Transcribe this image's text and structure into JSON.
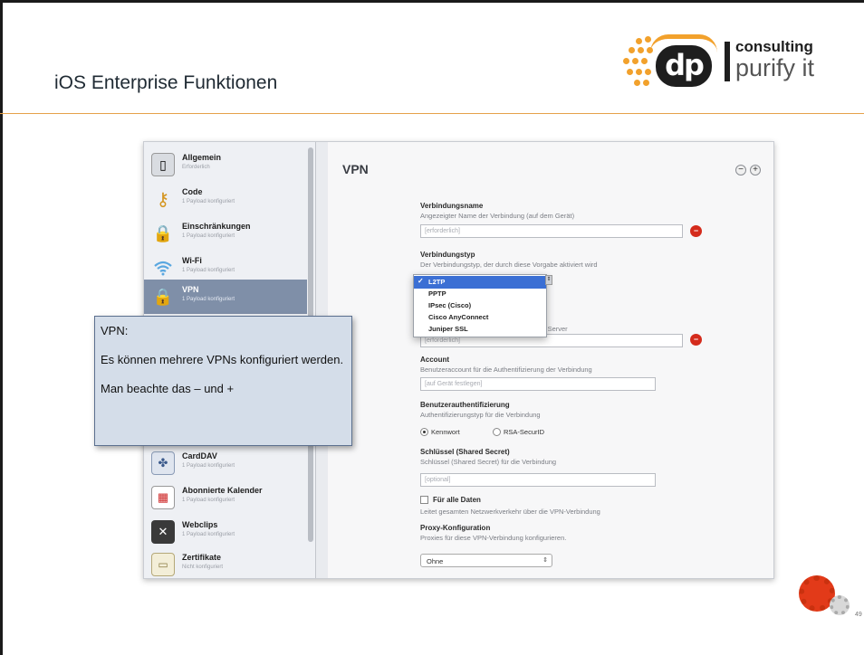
{
  "slide": {
    "title": "iOS Enterprise Funktionen",
    "page_number": "49",
    "accent_color": "#e6a14a"
  },
  "logo": {
    "mark": "dp",
    "line1": "consulting",
    "line2": "purify it"
  },
  "sidebar": {
    "items": [
      {
        "title": "Allgemein",
        "subtitle": "Erforderlich",
        "icon": "settings-switch-icon"
      },
      {
        "title": "Code",
        "subtitle": "1 Payload konfiguriert",
        "icon": "key-icon"
      },
      {
        "title": "Einschränkungen",
        "subtitle": "1 Payload konfiguriert",
        "icon": "lock-icon"
      },
      {
        "title": "Wi-Fi",
        "subtitle": "1 Payload konfiguriert",
        "icon": "wifi-icon"
      },
      {
        "title": "VPN",
        "subtitle": "1 Payload konfiguriert",
        "icon": "vpn-lock-icon",
        "selected": true
      },
      {
        "title": "CardDAV",
        "subtitle": "1 Payload konfiguriert",
        "icon": "contacts-icon"
      },
      {
        "title": "Abonnierte Kalender",
        "subtitle": "1 Payload konfiguriert",
        "icon": "calendar-icon"
      },
      {
        "title": "Webclips",
        "subtitle": "1 Payload konfiguriert",
        "icon": "webclip-icon"
      },
      {
        "title": "Zertifikate",
        "subtitle": "Nicht konfiguriert",
        "icon": "certificate-icon"
      }
    ]
  },
  "main": {
    "heading": "VPN",
    "minus": "−",
    "plus": "+",
    "connection_name": {
      "label": "Verbindungsname",
      "desc": "Angezeigter Name der Verbindung (auf dem Gerät)",
      "placeholder": "[erforderlich]"
    },
    "connection_type": {
      "label": "Verbindungstyp",
      "desc": "Der Verbindungstyp, der durch diese Vorgabe aktiviert wird",
      "options": [
        "L2TP",
        "PPTP",
        "IPsec (Cisco)",
        "Cisco AnyConnect",
        "Juniper SSL"
      ],
      "selected": "L2TP"
    },
    "server": {
      "desc_partial": "r Server",
      "placeholder": "[erforderlich]"
    },
    "account": {
      "label": "Account",
      "desc": "Benutzeraccount für die Authentifizierung der Verbindung",
      "placeholder": "[auf Gerät festlegen]"
    },
    "user_auth": {
      "label": "Benutzerauthentifizierung",
      "desc": "Authentifizierungstyp für die Verbindung",
      "option1": "Kennwort",
      "option2": "RSA-SecurID"
    },
    "shared_secret": {
      "label": "Schlüssel (Shared Secret)",
      "desc": "Schlüssel (Shared Secret) für die Verbindung",
      "placeholder": "[optional]"
    },
    "all_data": {
      "label": "Für alle Daten",
      "desc": "Leitet gesamten Netzwerkverkehr über die VPN-Verbindung"
    },
    "proxy": {
      "label": "Proxy-Konfiguration",
      "desc": "Proxies für diese VPN-Verbindung konfigurieren.",
      "value": "Ohne"
    }
  },
  "callout": {
    "line1": "VPN:",
    "line2": "Es können mehrere VPNs konfiguriert werden.",
    "line3": "Man beachte das – und +"
  }
}
